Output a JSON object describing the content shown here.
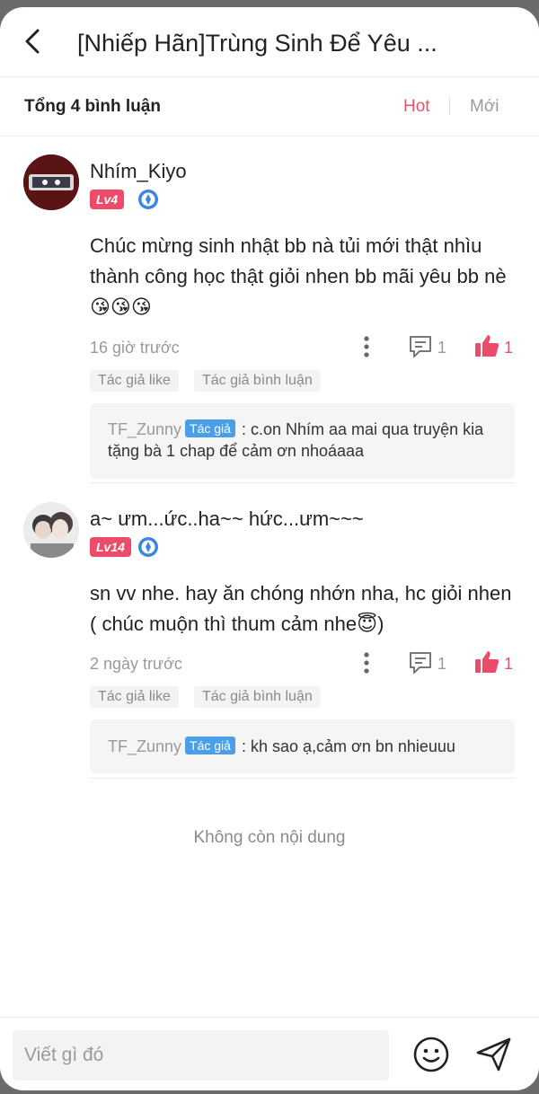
{
  "header": {
    "title": "[Nhiếp Hãn]Trùng Sinh Để Yêu ..."
  },
  "subbar": {
    "total": "Tổng 4 bình luận",
    "sort_hot": "Hot",
    "sort_new": "Mới"
  },
  "comments": [
    {
      "username": "Nhím_Kiyo",
      "level": "Lv4",
      "text": "Chúc mừng sinh nhật bb nà tủi mới thật nhìu thành công học thật giỏi nhen bb mãi yêu bb nè😘😘😘",
      "time": "16 giờ trước",
      "reply_count": "1",
      "like_count": "1",
      "tags": [
        "Tác giả like",
        "Tác giả bình luận"
      ],
      "reply": {
        "author": "TF_Zunny",
        "author_tag": "Tác giả",
        "text": ": c.on Nhím aa mai qua truyện kia tặng bà 1 chap để cảm ơn nhoáaaa"
      }
    },
    {
      "username": "a~ ưm...ức..ha~~ hức...ưm~~~",
      "level": "Lv14",
      "text": "sn vv nhe. hay ăn chóng nhớn nha, hc giỏi nhen ( chúc muộn thì thum cảm nhe😇)",
      "time": "2 ngày trước",
      "reply_count": "1",
      "like_count": "1",
      "tags": [
        "Tác giả like",
        "Tác giả bình luận"
      ],
      "reply": {
        "author": "TF_Zunny",
        "author_tag": "Tác giả",
        "text": ": kh sao ạ,cảm ơn bn nhieuuu"
      }
    }
  ],
  "end_note": "Không còn nội dung",
  "composer": {
    "placeholder": "Viết gì đó"
  },
  "colors": {
    "accent": "#e2566d",
    "level_badge": "#ee4b6a",
    "author_tag": "#4a9fe8"
  },
  "icons": [
    "back-arrow-icon",
    "more-vertical-icon",
    "reply-icon",
    "thumbs-up-icon",
    "medal-icon",
    "emoji-icon",
    "send-icon"
  ]
}
